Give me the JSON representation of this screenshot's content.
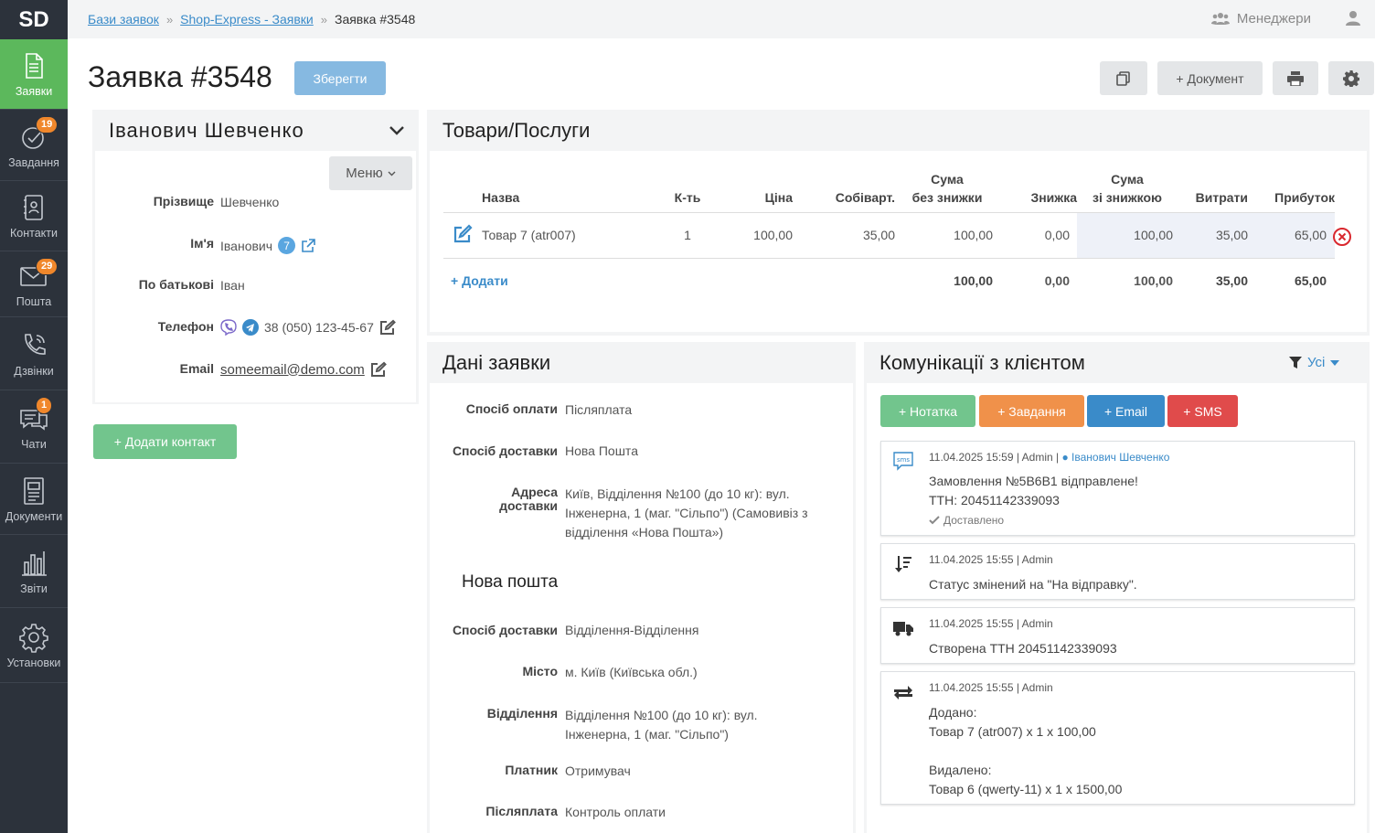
{
  "sidebar": {
    "logo": "SD",
    "items": [
      {
        "label": "Заявки",
        "icon": "document-icon"
      },
      {
        "label": "Завдання",
        "icon": "check-circle-icon",
        "badge": "19"
      },
      {
        "label": "Контакти",
        "icon": "contacts-icon"
      },
      {
        "label": "Пошта",
        "icon": "mail-icon",
        "badge": "29"
      },
      {
        "label": "Дзвінки",
        "icon": "phone-icon"
      },
      {
        "label": "Чати",
        "icon": "chat-icon",
        "badge": "1"
      },
      {
        "label": "Документи",
        "icon": "documents-icon"
      },
      {
        "label": "Звіти",
        "icon": "bar-chart-icon"
      },
      {
        "label": "Установки",
        "icon": "gear-icon"
      }
    ]
  },
  "topbar": {
    "breadcrumb": [
      "Бази заявок",
      "Shop-Express - Заявки",
      "Заявка #3548"
    ],
    "sep": "»",
    "managers": "Менеджери"
  },
  "page": {
    "title": "Заявка #3548",
    "save": "Зберегти",
    "add_doc": "+ Документ"
  },
  "contact": {
    "name": "Іванович Шевченко",
    "menu": "Меню",
    "fields": [
      {
        "label": "Прізвище",
        "value": "Шевченко"
      },
      {
        "label": "Ім'я",
        "value": "Іванович",
        "badge": "7"
      },
      {
        "label": "По батькові",
        "value": "Іван"
      },
      {
        "label": "Телефон",
        "value": "38 (050) 123-45-67"
      },
      {
        "label": "Email",
        "value": "someemail@demo.com"
      }
    ],
    "add_contact": "+ Додати контакт"
  },
  "products": {
    "title": "Товари/Послуги",
    "columns": [
      "Назва",
      "К-ть",
      "Ціна",
      "Собіварт.",
      "Сума",
      "без знижки",
      "Знижка",
      "Сума",
      "зі знижкою",
      "Витрати",
      "Прибуток"
    ],
    "row": {
      "name": "Товар 7 (atr007)",
      "qty": "1",
      "price": "100,00",
      "cost": "35,00",
      "sum": "100,00",
      "discount": "0,00",
      "sum_disc": "100,00",
      "expenses": "35,00",
      "profit": "65,00"
    },
    "add": "+ Додати",
    "totals": {
      "sum": "100,00",
      "discount": "0,00",
      "sum_disc": "100,00",
      "expenses": "35,00",
      "profit": "65,00"
    }
  },
  "order": {
    "title": "Дані заявки",
    "payment_label": "Спосіб оплати",
    "payment": "Післяплата",
    "delivery_label": "Спосіб доставки",
    "delivery": "Нова Пошта",
    "address_label1": "Адреса",
    "address_label2": "доставки",
    "address": [
      "Київ, Відділення №100 (до 10 кг): вул.",
      "Інженерна, 1 (маг. \"Сільпо\") (Самовивіз з",
      "відділення «Нова Пошта»)"
    ],
    "np_title": "Нова пошта",
    "np_method_label": "Спосіб доставки",
    "np_method": "Відділення-Відділення",
    "city_label": "Місто",
    "city": "м. Київ (Київська обл.)",
    "branch_label": "Відділення",
    "branch": [
      "Відділення №100 (до 10 кг): вул.",
      "Інженерна, 1 (маг. \"Сільпо\")"
    ],
    "payer_label": "Платник",
    "payer": "Отримувач",
    "cod_label": "Післяплата",
    "cod": "Контроль оплати"
  },
  "comms": {
    "title": "Комунікації з клієнтом",
    "filter": "Усі",
    "buttons": {
      "note": "+ Нотатка",
      "task": "+ Завдання",
      "email": "+ Email",
      "sms": "+ SMS"
    },
    "items": [
      {
        "icon": "sms-icon",
        "meta": "11.04.2025 15:59 | Admin | ",
        "person": "Іванович Шевченко",
        "lines": [
          "Замовлення №5B6B1 відправлене!",
          "ТТН: 20451142339093"
        ],
        "status": "Доставлено"
      },
      {
        "icon": "sort-icon",
        "meta": "11.04.2025 15:55 | Admin",
        "lines": [
          "Статус змінений на \"На відправку\"."
        ]
      },
      {
        "icon": "truck-icon",
        "meta": "11.04.2025 15:55 | Admin",
        "lines": [
          "Створена ТТН 20451142339093"
        ]
      },
      {
        "icon": "exchange-icon",
        "meta": "11.04.2025 15:55 | Admin",
        "lines": [
          "Додано:",
          "Товар 7 (atr007) х 1 х 100,00",
          "",
          "Видалено:",
          "Товар 6 (qwerty-11) х 1 х 1500,00"
        ]
      }
    ]
  },
  "colors": {
    "green": "#5cb85c",
    "orange": "#f0872b",
    "blue": "#3a8bc9",
    "red": "#e04b4b",
    "sidebar": "#2c323b"
  }
}
